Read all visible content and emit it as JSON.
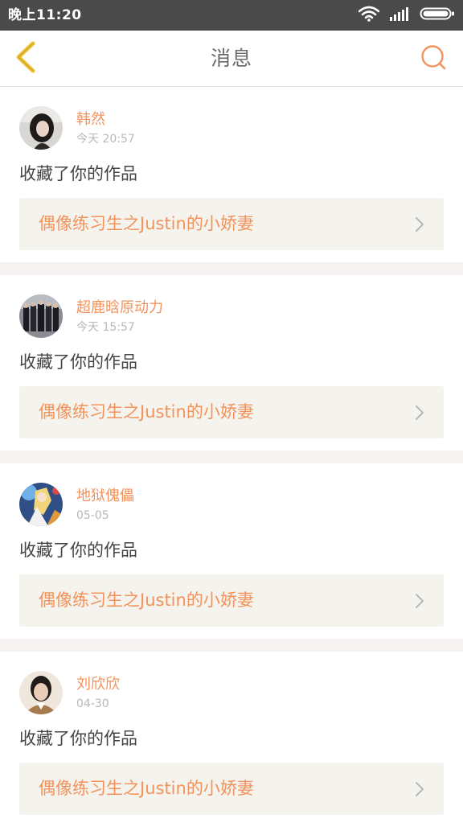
{
  "status_bar": {
    "time": "晚上11:20",
    "icons": [
      "wifi-icon",
      "signal-icon",
      "battery-icon"
    ]
  },
  "header": {
    "title": "消息",
    "back_icon": "chevron-left-icon",
    "search_icon": "search-icon"
  },
  "colors": {
    "accent": "#f3935b",
    "back_arrow": "#f2c230",
    "link_background": "#f4f3ed",
    "status_bar": "#4a4a4a"
  },
  "messages": [
    {
      "user": "韩然",
      "time": "今天 20:57",
      "action": "收藏了你的作品",
      "work_title": "偶像练习生之Justin的小娇妻",
      "avatar_icon": "avatar-dark-hair"
    },
    {
      "user": "超鹿晗原动力",
      "time": "今天 15:57",
      "action": "收藏了你的作品",
      "work_title": "偶像练习生之Justin的小娇妻",
      "avatar_icon": "avatar-group-photo"
    },
    {
      "user": "地狱傀儡",
      "time": "05-05",
      "action": "收藏了你的作品",
      "work_title": "偶像练习生之Justin的小娇妻",
      "avatar_icon": "avatar-anime"
    },
    {
      "user": "刘欣欣",
      "time": "04-30",
      "action": "收藏了你的作品",
      "work_title": "偶像练习生之Justin的小娇妻",
      "avatar_icon": "avatar-portrait"
    }
  ]
}
